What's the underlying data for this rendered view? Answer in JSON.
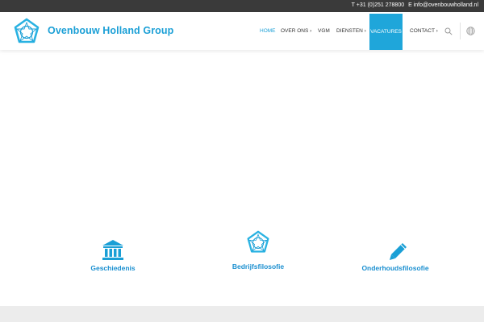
{
  "topbar": {
    "phone": "T +31 (0)251 278800",
    "email": "E info@ovenbouwholland.nl"
  },
  "header": {
    "brand": "Ovenbouw Holland Group",
    "logo_icon": "pentagon-star-logo-icon"
  },
  "nav": {
    "home": "HOME",
    "over_ons": "OVER ONS ›",
    "vgm": "VGM",
    "diensten": "DIENSTEN ›",
    "vacatures": "VACATURES",
    "contact": "CONTACT ›",
    "search_icon": "search-icon",
    "language_icon": "globe-icon"
  },
  "features": [
    {
      "label": "Geschiedenis",
      "icon": "bank-building-icon"
    },
    {
      "label": "Bedrijfsfilosofie",
      "icon": "pentagon-star-logo-icon"
    },
    {
      "label": "Onderhoudsfilosofie",
      "icon": "pencil-icon"
    }
  ],
  "colors": {
    "accent": "#1a9fd6",
    "topbar_bg": "#3a3a3a",
    "active_nav_bg": "#1fa6da"
  }
}
